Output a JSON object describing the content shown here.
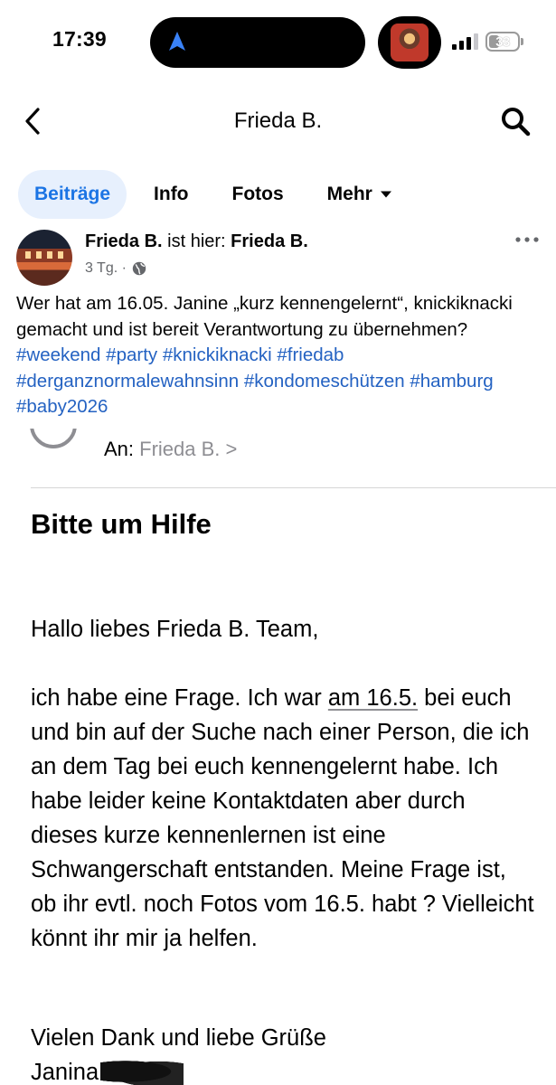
{
  "status_bar": {
    "time": "17:39",
    "battery": "33",
    "icons": [
      "navigation-arrow-icon",
      "cellular-signal-icon",
      "battery-icon"
    ]
  },
  "header": {
    "title": "Frieda B.",
    "icons": [
      "back-chevron-icon",
      "search-icon"
    ]
  },
  "tabs": [
    {
      "label": "Beiträge",
      "active": true
    },
    {
      "label": "Info",
      "active": false
    },
    {
      "label": "Fotos",
      "active": false
    },
    {
      "label": "Mehr",
      "active": false
    }
  ],
  "post": {
    "author": "Frieda B.",
    "action": "ist hier:",
    "location": "Frieda B.",
    "time_ago": "3 Tg. ·",
    "text": "Wer hat am 16.05. Janine „kurz kennengelernt“, knickiknacki gemacht und ist bereit Verantwortung zu übernehmen?",
    "hashtags": [
      "#weekend",
      "#party",
      "#knickiknacki",
      "#friedab",
      "#derganznormalewahnsinn",
      "#kondomeschützen",
      "#hamburg",
      "#baby2026"
    ]
  },
  "mail": {
    "to_label": "An:",
    "to_name": "Frieda B. >",
    "subject": "Bitte um Hilfe",
    "greeting": "Hallo liebes Frieda B. Team,",
    "body_pre": "ich habe eine Frage. Ich war ",
    "body_link": "am 16.5.",
    "body_post": " bei euch und bin auf der Suche nach einer Person, die ich an dem Tag bei euch kennengelernt habe. Ich habe leider keine Kontaktdaten aber durch dieses kurze kennenlernen ist eine Schwangerschaft entstanden. Meine Frage ist, ob ihr evtl. noch Fotos vom 16.5. habt ? Vielleicht könnt ihr mir ja helfen.",
    "closing": "Vielen Dank und liebe Grüße",
    "signature": "Janina"
  },
  "colors": {
    "accent": "#1b74e4",
    "tab_active_bg": "#e7f0fd",
    "hashtag": "#2462c2",
    "secondary_text": "#65676b",
    "mail_gray": "#8e8e93"
  }
}
